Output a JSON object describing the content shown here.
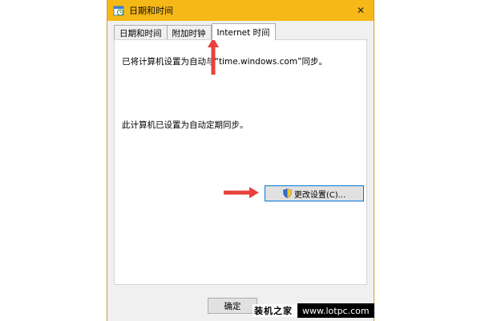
{
  "window": {
    "title": "日期和时间",
    "close_glyph": "✕"
  },
  "tabs": [
    {
      "label": "日期和时间",
      "active": false
    },
    {
      "label": "附加时钟",
      "active": false
    },
    {
      "label": "Internet 时间",
      "active": true
    }
  ],
  "internet_time": {
    "sync_status": "已将计算机设置为自动与“time.windows.com”同步。",
    "auto_sync_status": "此计算机已设置为自动定期同步。",
    "change_settings_label": "更改设置(C)..."
  },
  "footer": {
    "ok_label": "确定"
  },
  "watermark": {
    "site_name": "装机之家",
    "url": "www.lotpc.com"
  },
  "colors": {
    "titlebar": "#f6b817",
    "annotation_arrow": "#e8413e",
    "focus_border": "#0078d7"
  },
  "icons": {
    "app": "calendar-clock-icon",
    "close": "close-icon",
    "uac": "shield-icon"
  }
}
